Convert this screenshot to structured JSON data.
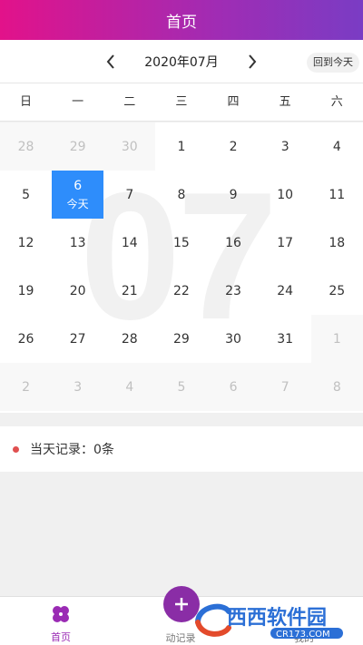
{
  "header": {
    "title": "首页"
  },
  "monthbar": {
    "month": "2020年07月",
    "today_button": "回到今天"
  },
  "weekdays": [
    "日",
    "一",
    "二",
    "三",
    "四",
    "五",
    "六"
  ],
  "calendar": {
    "watermark": "07",
    "today_label": "今天",
    "cells": [
      {
        "d": "28",
        "other": true,
        "shade": true
      },
      {
        "d": "29",
        "other": true,
        "shade": true
      },
      {
        "d": "30",
        "other": true,
        "shade": true
      },
      {
        "d": "1"
      },
      {
        "d": "2"
      },
      {
        "d": "3"
      },
      {
        "d": "4"
      },
      {
        "d": "5"
      },
      {
        "d": "6",
        "today": true
      },
      {
        "d": "7"
      },
      {
        "d": "8"
      },
      {
        "d": "9"
      },
      {
        "d": "10"
      },
      {
        "d": "11"
      },
      {
        "d": "12"
      },
      {
        "d": "13"
      },
      {
        "d": "14"
      },
      {
        "d": "15"
      },
      {
        "d": "16"
      },
      {
        "d": "17"
      },
      {
        "d": "18"
      },
      {
        "d": "19"
      },
      {
        "d": "20"
      },
      {
        "d": "21"
      },
      {
        "d": "22"
      },
      {
        "d": "23"
      },
      {
        "d": "24"
      },
      {
        "d": "25"
      },
      {
        "d": "26"
      },
      {
        "d": "27"
      },
      {
        "d": "28"
      },
      {
        "d": "29"
      },
      {
        "d": "30"
      },
      {
        "d": "31"
      },
      {
        "d": "1",
        "other": true,
        "shade": true
      },
      {
        "d": "2",
        "other": true,
        "shade": true
      },
      {
        "d": "3",
        "other": true,
        "shade": true
      },
      {
        "d": "4",
        "other": true,
        "shade": true
      },
      {
        "d": "5",
        "other": true,
        "shade": true
      },
      {
        "d": "6",
        "other": true,
        "shade": true
      },
      {
        "d": "7",
        "other": true,
        "shade": true
      },
      {
        "d": "8",
        "other": true,
        "shade": true
      }
    ]
  },
  "records": {
    "text": "当天记录：0条"
  },
  "tabbar": {
    "home": "首页",
    "dynamic": "动记录",
    "mine": "我的"
  },
  "watermark_logo": {
    "text": "西西软件园",
    "url_text": "CR173.COM"
  },
  "colors": {
    "accent": "#9a2bb4",
    "today": "#2e8dfb",
    "dot": "#e05050"
  }
}
